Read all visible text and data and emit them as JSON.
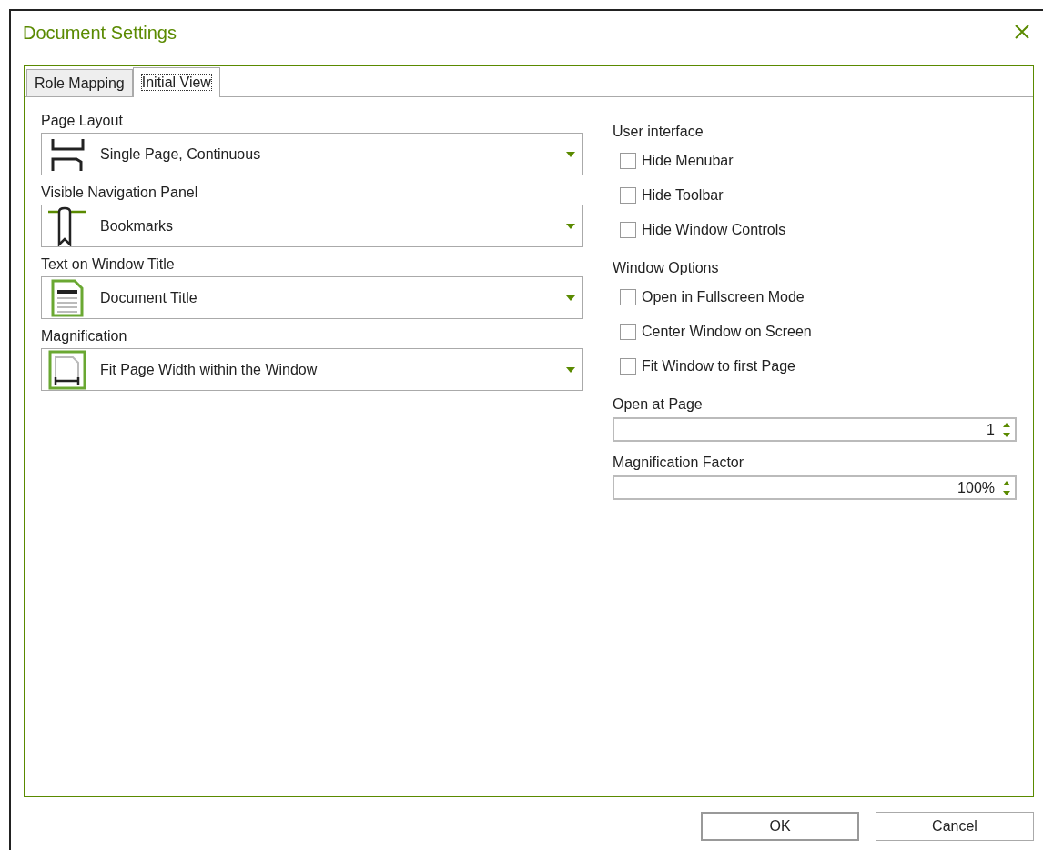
{
  "window": {
    "title": "Document Settings"
  },
  "tabs": [
    {
      "label": "Role Mapping",
      "selected": false
    },
    {
      "label": "Initial View",
      "selected": true
    }
  ],
  "dropdowns": [
    {
      "label": "Page Layout",
      "value": "Single Page, Continuous"
    },
    {
      "label": "Visible Navigation Panel",
      "value": "Bookmarks"
    },
    {
      "label": "Text on Window Title",
      "value": "Document Title"
    },
    {
      "label": "Magnification",
      "value": "Fit Page Width within the Window"
    }
  ],
  "groups": [
    {
      "title": "User interface",
      "options": [
        {
          "label": "Hide Menubar",
          "checked": false
        },
        {
          "label": "Hide Toolbar",
          "checked": false
        },
        {
          "label": "Hide Window Controls",
          "checked": false
        }
      ]
    },
    {
      "title": "Window Options",
      "options": [
        {
          "label": "Open in Fullscreen Mode",
          "checked": false
        },
        {
          "label": "Center Window on Screen",
          "checked": false
        },
        {
          "label": "Fit Window to first Page",
          "checked": false
        }
      ]
    }
  ],
  "spinners": [
    {
      "label": "Open at Page",
      "value": "1"
    },
    {
      "label": "Magnification Factor",
      "value": "100%"
    }
  ],
  "buttons": [
    {
      "label": "OK",
      "default": true
    },
    {
      "label": "Cancel",
      "default": false
    }
  ]
}
